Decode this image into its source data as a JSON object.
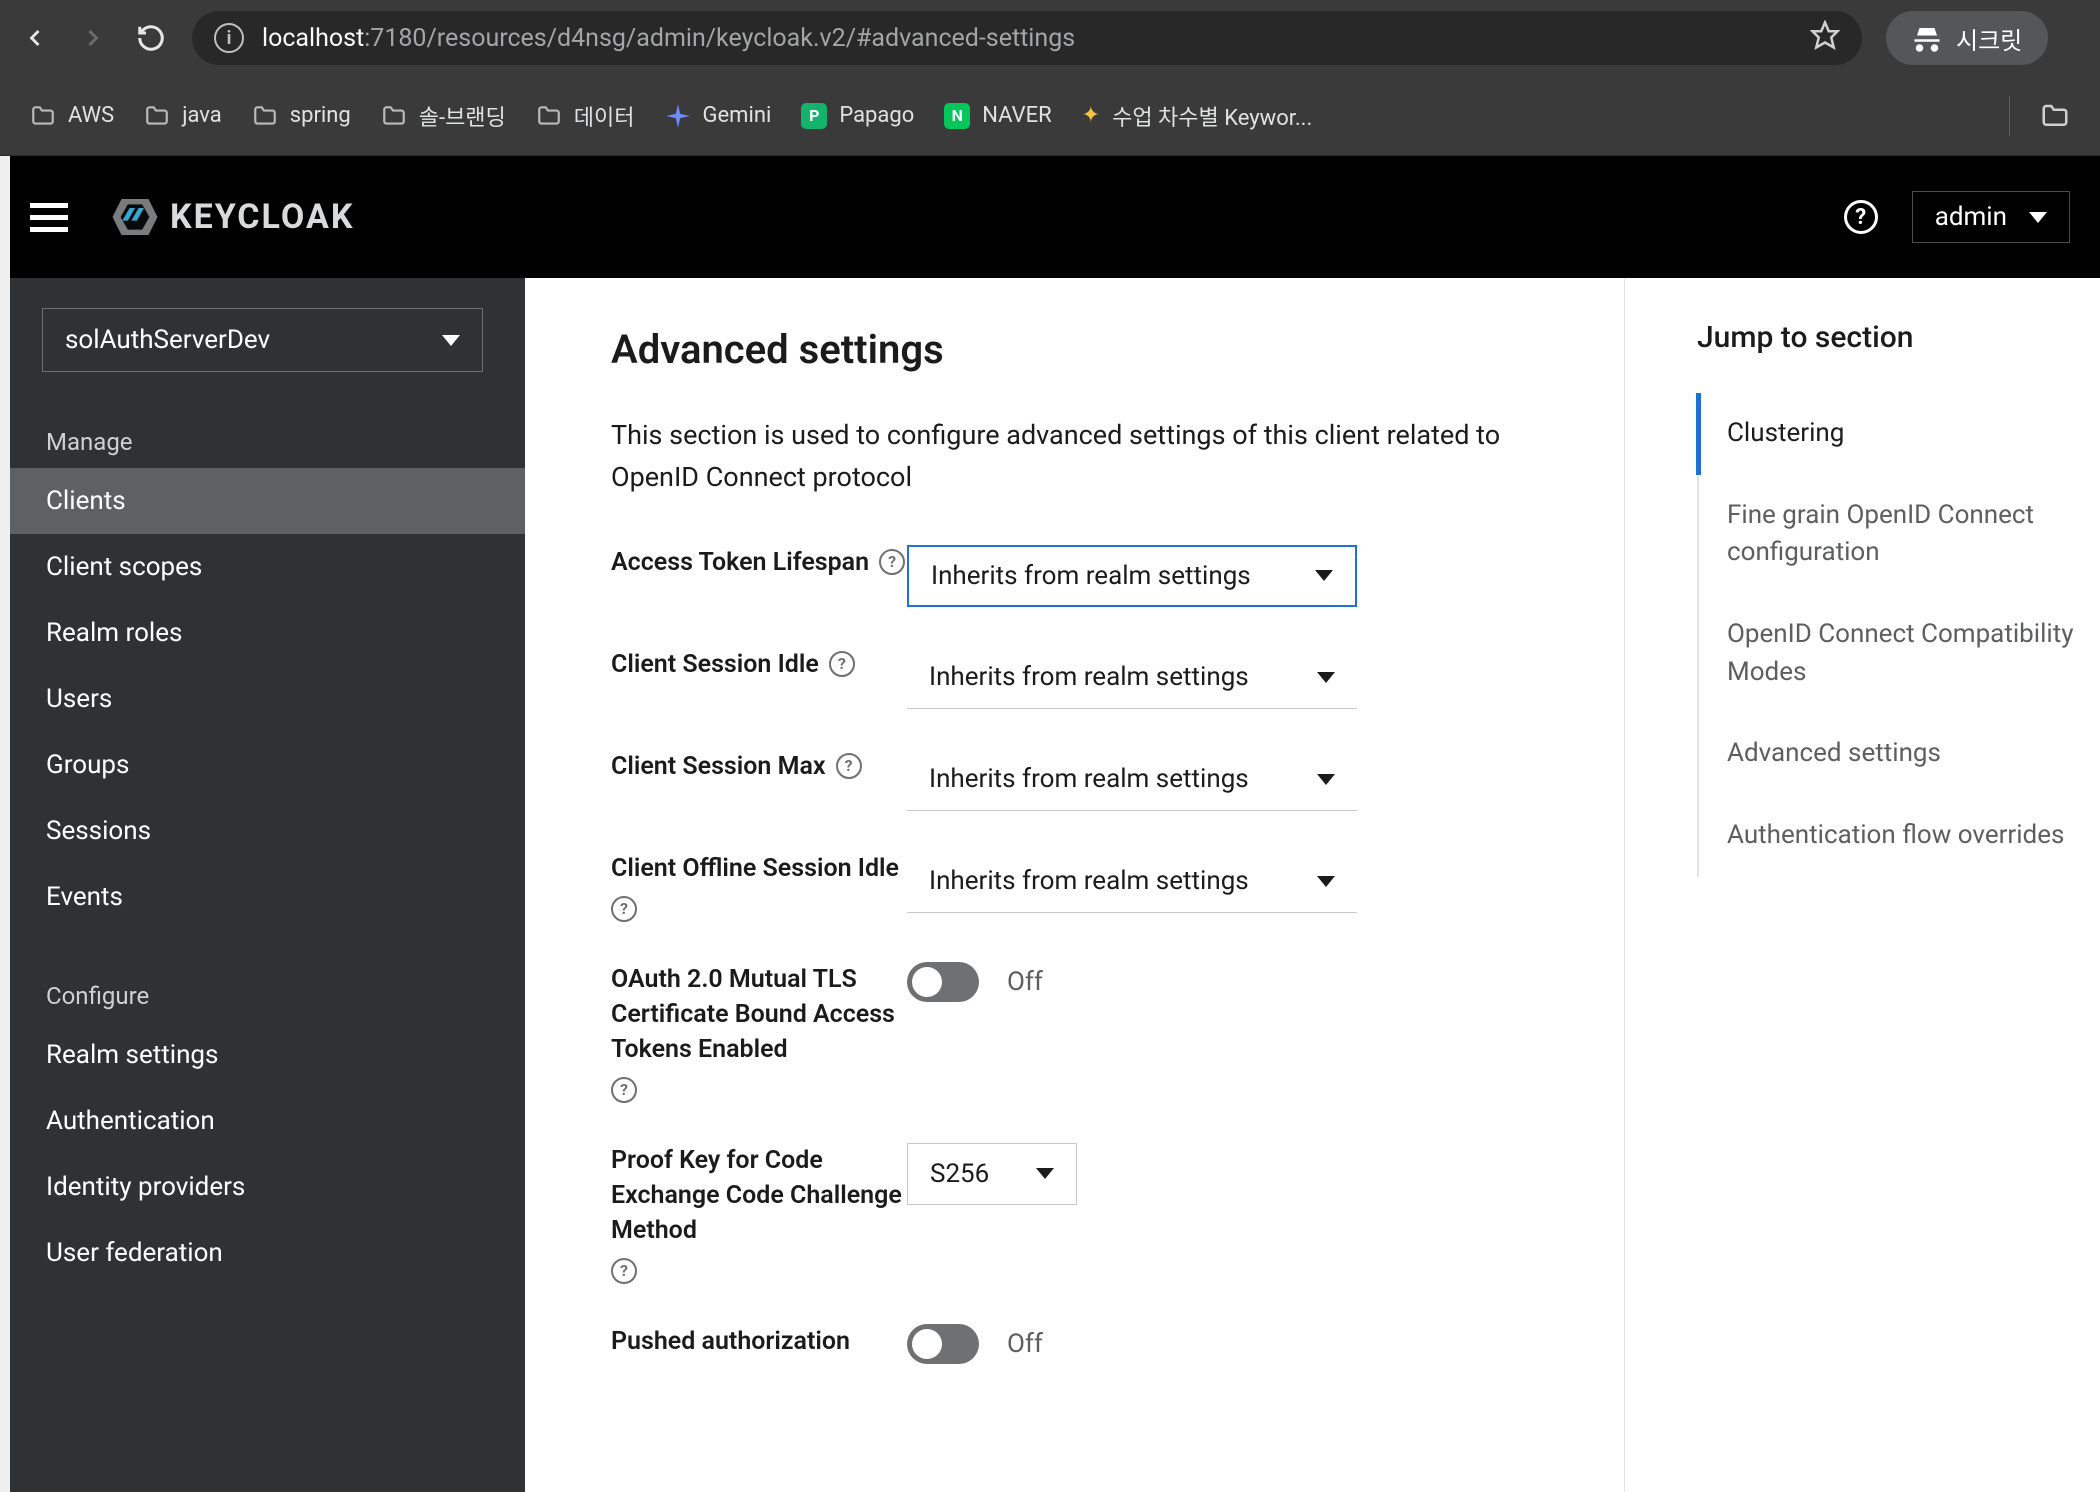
{
  "browser": {
    "url_host": "localhost",
    "url_rest": ":7180/resources/d4nsg/admin/keycloak.v2/#advanced-settings",
    "incognito_label": "시크릿"
  },
  "bookmarks": [
    {
      "label": "AWS",
      "kind": "folder"
    },
    {
      "label": "java",
      "kind": "folder"
    },
    {
      "label": "spring",
      "kind": "folder"
    },
    {
      "label": "솔-브랜딩",
      "kind": "folder"
    },
    {
      "label": "데이터",
      "kind": "folder"
    },
    {
      "label": "Gemini",
      "kind": "gemini"
    },
    {
      "label": "Papago",
      "kind": "papago"
    },
    {
      "label": "NAVER",
      "kind": "naver"
    },
    {
      "label": "수업 차수별 Keywor...",
      "kind": "sparkle"
    }
  ],
  "header": {
    "logo_text": "KEYCLOAK",
    "user": "admin"
  },
  "sidebar": {
    "realm": "solAuthServerDev",
    "section_manage": "Manage",
    "section_configure": "Configure",
    "manage_items": [
      "Clients",
      "Client scopes",
      "Realm roles",
      "Users",
      "Groups",
      "Sessions",
      "Events"
    ],
    "configure_items": [
      "Realm settings",
      "Authentication",
      "Identity providers",
      "User federation"
    ],
    "active_item": "Clients"
  },
  "content": {
    "title": "Advanced settings",
    "desc": "This section is used to configure advanced settings of this client related to OpenID Connect protocol",
    "inherit_label": "Inherits from realm settings",
    "rows": {
      "access_token_lifespan": "Access Token Lifespan",
      "client_session_idle": "Client Session Idle",
      "client_session_max": "Client Session Max",
      "client_offline_session_idle": "Client Offline Session Idle",
      "oauth_mtls": "OAuth 2.0 Mutual TLS Certificate Bound Access Tokens Enabled",
      "pkce": "Proof Key for Code Exchange Code Challenge Method",
      "pushed_auth": "Pushed authorization"
    },
    "pkce_value": "S256",
    "off_label": "Off"
  },
  "jump": {
    "title": "Jump to section",
    "items": [
      "Clustering",
      "Fine grain OpenID Connect configuration",
      "OpenID Connect Compatibility Modes",
      "Advanced settings",
      "Authentication flow overrides"
    ],
    "active_index": 0
  }
}
